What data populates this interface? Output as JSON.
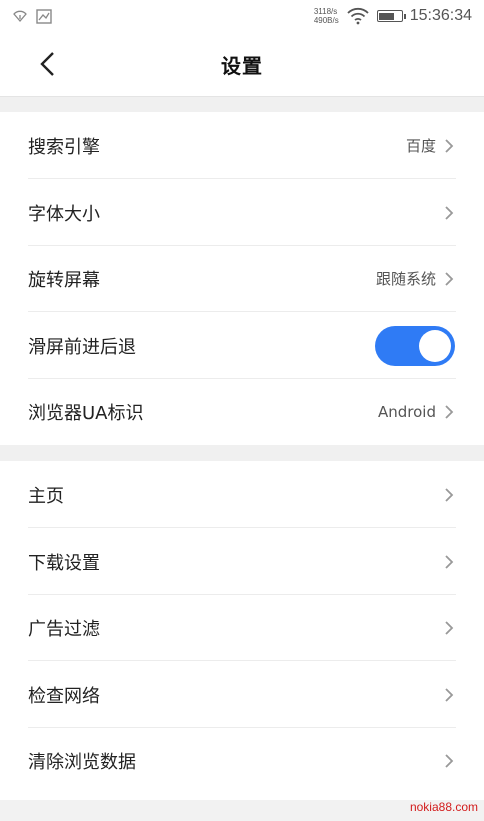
{
  "status_bar": {
    "speed_up": "3118/s",
    "speed_down": "490B/s",
    "time": "15:36:34",
    "icons": [
      "signal-icon",
      "image-icon",
      "wifi-icon",
      "battery-icon"
    ]
  },
  "header": {
    "title": "设置"
  },
  "section1": [
    {
      "label": "搜索引擎",
      "value": "百度"
    },
    {
      "label": "字体大小",
      "value": ""
    },
    {
      "label": "旋转屏幕",
      "value": "跟随系统"
    },
    {
      "label": "滑屏前进后退",
      "toggle_on": true
    },
    {
      "label": "浏览器UA标识",
      "value": "Android"
    }
  ],
  "section2": [
    {
      "label": "主页"
    },
    {
      "label": "下载设置"
    },
    {
      "label": "广告过滤"
    },
    {
      "label": "检查网络"
    },
    {
      "label": "清除浏览数据"
    }
  ],
  "watermark": "nokia88.com",
  "colors": {
    "accent": "#2f7bf5",
    "watermark": "#d21c1c"
  }
}
